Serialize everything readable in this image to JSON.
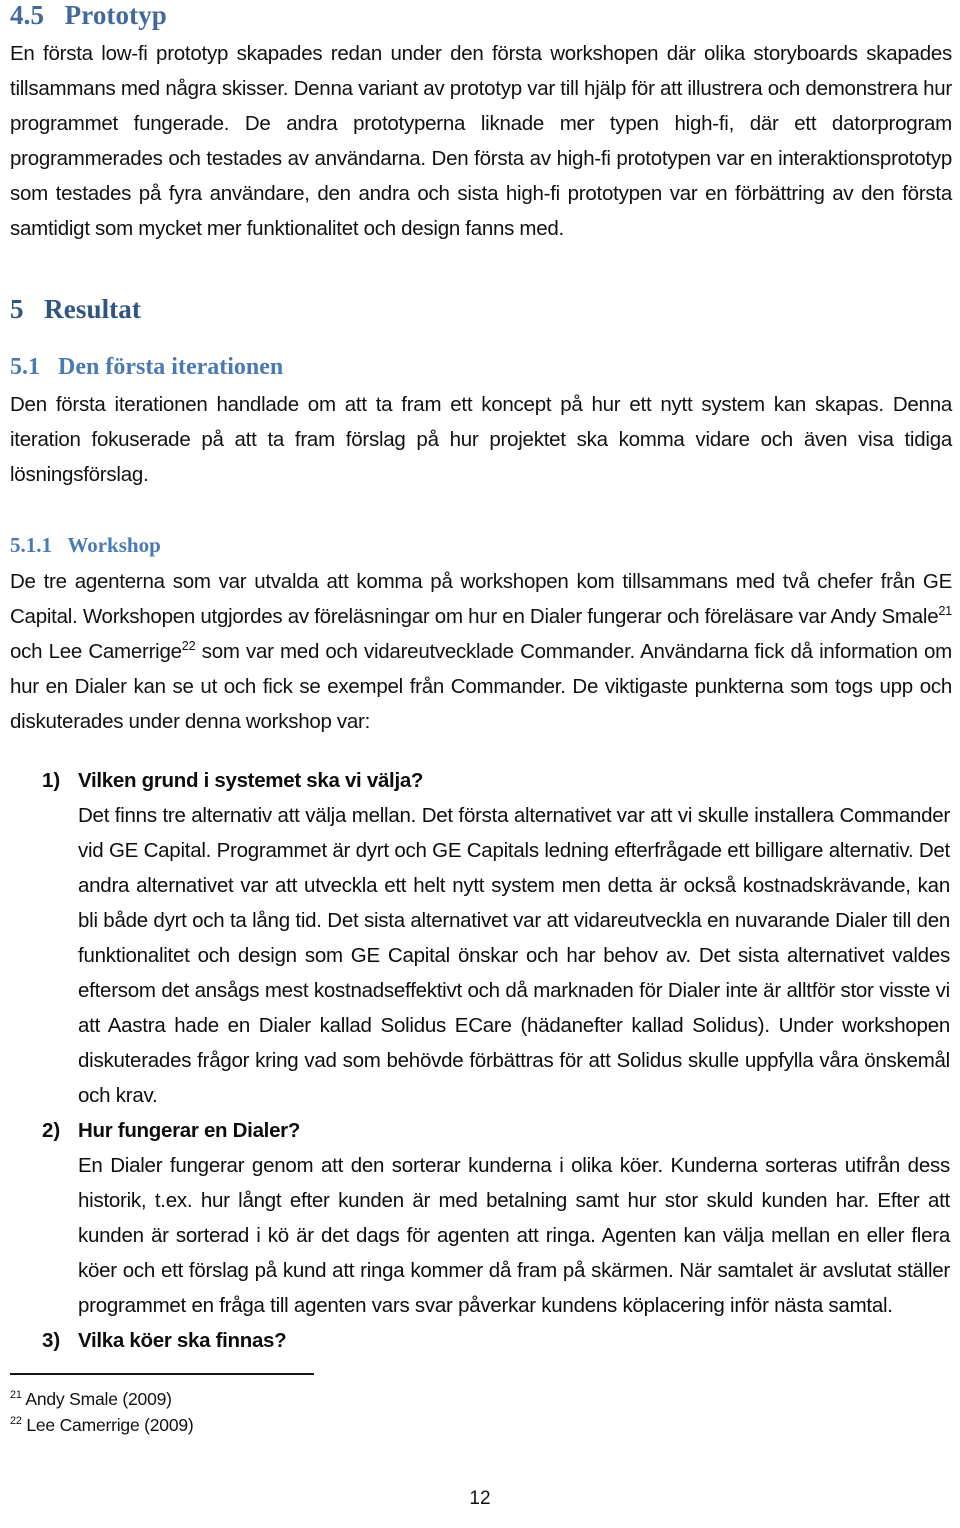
{
  "document": {
    "language": "sv",
    "page_number": "12",
    "heading_color_light": "#4a7ab4",
    "heading_color_dark": "#2f5580",
    "body_color": "#111111"
  },
  "sections": {
    "prototyp": {
      "number": "4.5",
      "title": "Prototyp",
      "paragraph": "En första low-fi prototyp skapades redan under den första workshopen där olika storyboards skapades tillsammans med några skisser. Denna variant av prototyp var till hjälp för att illustrera och demonstrera hur programmet fungerade. De andra prototyperna liknade mer typen high-fi, där ett datorprogram programmerades och testades av användarna. Den första av high-fi prototypen var en interaktionsprototyp som testades på fyra användare, den andra och sista high-fi prototypen var en förbättring av den första samtidigt som mycket mer funktionalitet och design fanns med."
    },
    "resultat": {
      "number": "5",
      "title": "Resultat"
    },
    "forsta_iterationen": {
      "number": "5.1",
      "title": "Den första iterationen",
      "paragraph": "Den första iterationen handlade om att ta fram ett koncept på hur ett nytt system kan skapas. Denna iteration fokuserade på att ta fram förslag på hur projektet ska komma vidare och även visa tidiga lösningsförslag."
    },
    "workshop": {
      "number": "5.1.1",
      "title": "Workshop",
      "paragraph_part1": "De tre agenterna som var utvalda att komma på workshopen kom tillsammans med två chefer från GE Capital. Workshopen utgjordes av föreläsningar om hur en Dialer fungerar och föreläsare var Andy Smale",
      "footnote_ref_1": "21",
      "paragraph_part2": " och Lee Camerrige",
      "footnote_ref_2": "22",
      "paragraph_part3": " som var med och vidareutvecklade Commander. Användarna fick då information om hur en Dialer kan se ut och fick se exempel från Commander. De viktigaste punkterna som togs upp och diskuterades under denna workshop var:"
    }
  },
  "questions": [
    {
      "marker": "1)",
      "title": "Vilken grund i systemet ska vi välja?",
      "body": "Det finns tre alternativ att välja mellan. Det första alternativet var att vi skulle installera Commander vid GE Capital. Programmet är dyrt och GE Capitals ledning efterfrågade ett billigare alternativ. Det andra alternativet var att utveckla ett helt nytt system men detta är också kostnadskrävande, kan bli både dyrt och ta lång tid. Det sista alternativet var att vidareutveckla en nuvarande Dialer till den funktionalitet och design som GE Capital önskar och har behov av. Det sista alternativet valdes eftersom det ansågs mest kostnadseffektivt och då marknaden för Dialer inte är alltför stor visste vi att Aastra hade en Dialer kallad Solidus ECare (hädanefter kallad Solidus). Under workshopen diskuterades frågor kring vad som behövde förbättras för att Solidus skulle uppfylla våra önskemål och krav."
    },
    {
      "marker": "2)",
      "title": "Hur fungerar en Dialer?",
      "body": "En Dialer fungerar genom att den sorterar kunderna i olika köer. Kunderna sorteras utifrån dess historik, t.ex. hur långt efter kunden är med betalning samt hur stor skuld kunden har. Efter att kunden är sorterad i kö är det dags för agenten att ringa. Agenten kan välja mellan en eller flera köer och ett förslag på kund att ringa kommer då fram på skärmen. När samtalet är avslutat ställer programmet en fråga till agenten vars svar påverkar kundens köplacering inför nästa samtal."
    },
    {
      "marker": "3)",
      "title": "Vilka köer ska finnas?",
      "body": ""
    }
  ],
  "footnotes": [
    {
      "marker": "21",
      "text": " Andy Smale (2009)"
    },
    {
      "marker": "22",
      "text": " Lee Camerrige (2009)"
    }
  ]
}
